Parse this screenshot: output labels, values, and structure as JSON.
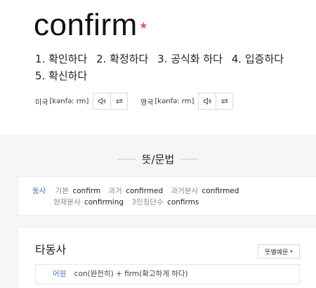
{
  "entry": {
    "headword": "confirm",
    "star": "★",
    "meanings": [
      "1. 확인하다",
      "2. 확정하다",
      "3. 공식화 하다",
      "4. 입증하다",
      "5. 확신하다"
    ]
  },
  "pronunciations": [
    {
      "region": "미국",
      "ipa": "[kənfəː rm]"
    },
    {
      "region": "영국",
      "ipa": "[kənfəː rm]"
    }
  ],
  "icons": {
    "play": "speaker-icon",
    "repeat": "repeat-icon"
  },
  "section": {
    "title": "뜻/문법"
  },
  "forms": {
    "pos": "동사",
    "row1": [
      {
        "label": "기본",
        "value": "confirm"
      },
      {
        "label": "과거",
        "value": "confirmed"
      },
      {
        "label": "과거분사",
        "value": "confirmed"
      }
    ],
    "row2": [
      {
        "label": "현재분사",
        "value": "confirming"
      },
      {
        "label": "3인칭단수",
        "value": "confirms"
      }
    ]
  },
  "meaning_card": {
    "pos_heading": "타동사",
    "example_button": "뜻별예문",
    "caret": "▾",
    "etymology_label": "어원",
    "etymology_text": "con(완전히) + firm(확고하게 하다)"
  },
  "colors": {
    "accent": "#4f72b6",
    "star": "#e0566a"
  }
}
